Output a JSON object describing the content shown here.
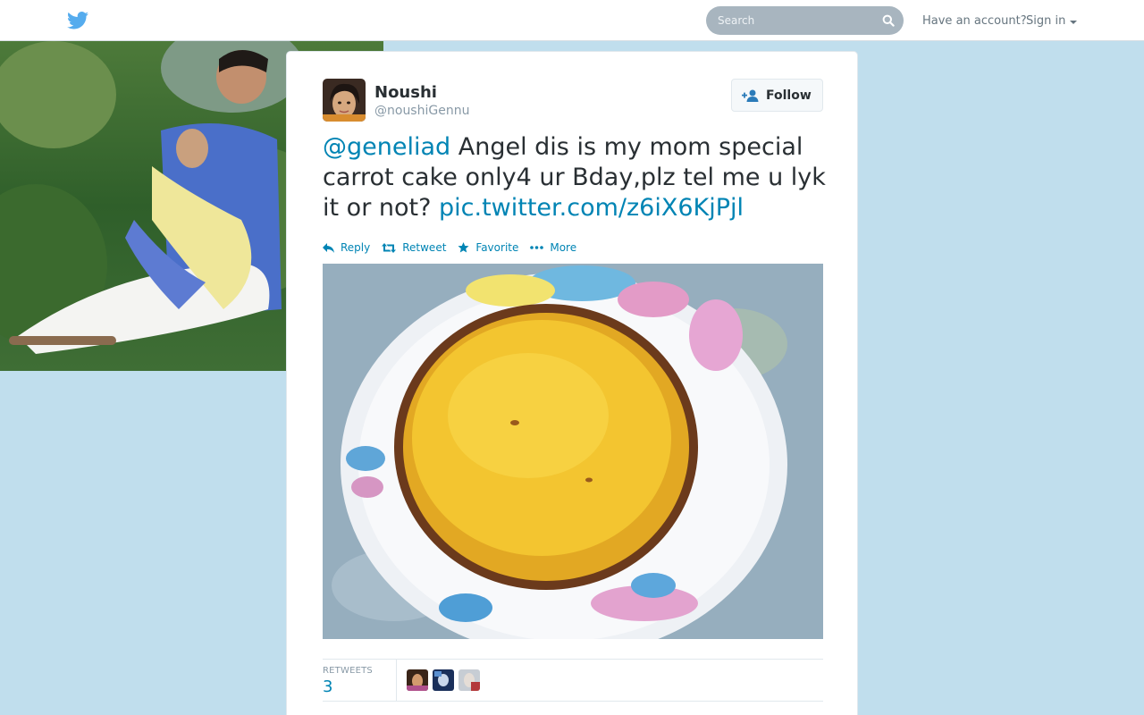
{
  "nav": {
    "search_placeholder": "Search",
    "have_account": "Have an account?",
    "sign_in": "Sign in",
    "logo_icon": "twitter-bird-icon"
  },
  "tweet": {
    "fullname": "Noushi",
    "username": "@noushiGennu",
    "follow_label": "Follow",
    "mention": "@geneliad",
    "text": " Angel dis is my mom special carrot cake only4 ur Bday,plz tel me u lyk it or not? ",
    "link": "pic.twitter.com/z6iX6KjPjl",
    "actions": {
      "reply": "Reply",
      "retweet": "Retweet",
      "favorite": "Favorite",
      "more": "More"
    },
    "stats": {
      "retweets_label": "RETWEETS",
      "retweets_count": "3"
    }
  },
  "colors": {
    "accent": "#0084b4",
    "background": "#c0deed",
    "bird": "#55acee"
  }
}
